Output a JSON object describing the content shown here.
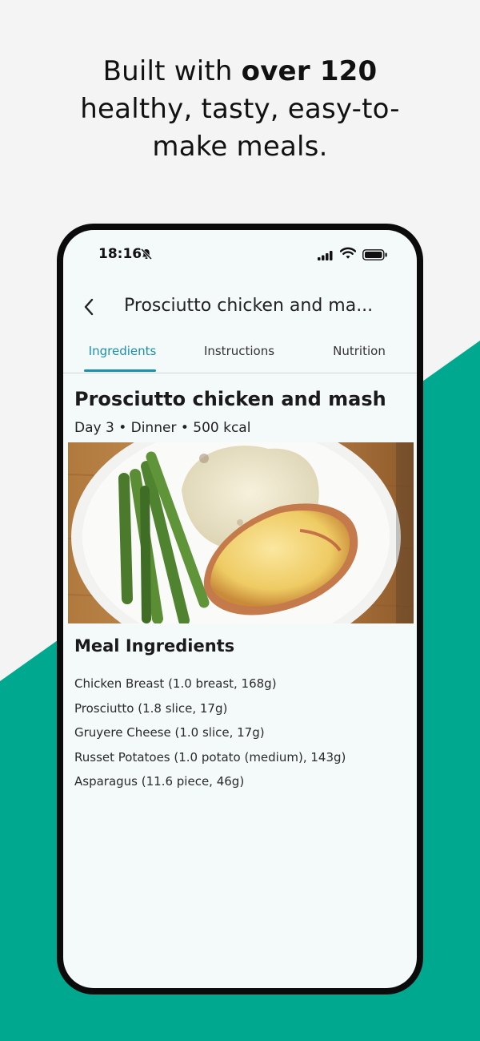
{
  "headline": {
    "part1": "Built with ",
    "bold": "over 120",
    "part2": "healthy, tasty, easy-to-",
    "part3": "make meals."
  },
  "colors": {
    "accent": "#00a88f",
    "tab_active": "#1a8fb0"
  },
  "status_bar": {
    "time": "18:16",
    "icons": [
      "bell-muted-icon",
      "cellular-signal-icon",
      "wifi-icon",
      "battery-icon"
    ]
  },
  "app_bar": {
    "back_icon": "chevron-left-icon",
    "title": "Prosciutto chicken and ma..."
  },
  "tabs": [
    {
      "label": "Ingredients",
      "active": true
    },
    {
      "label": "Instructions",
      "active": false
    },
    {
      "label": "Nutrition",
      "active": false
    }
  ],
  "recipe": {
    "title": "Prosciutto chicken and mash",
    "meta": "Day 3 • Dinner • 500 kcal"
  },
  "ingredients_section": {
    "title": "Meal Ingredients",
    "items": [
      "Chicken Breast (1.0 breast, 168g)",
      "Prosciutto (1.8 slice, 17g)",
      "Gruyere Cheese (1.0 slice, 17g)",
      "Russet Potatoes (1.0 potato (medium), 143g)",
      "Asparagus (11.6 piece, 46g)"
    ]
  }
}
